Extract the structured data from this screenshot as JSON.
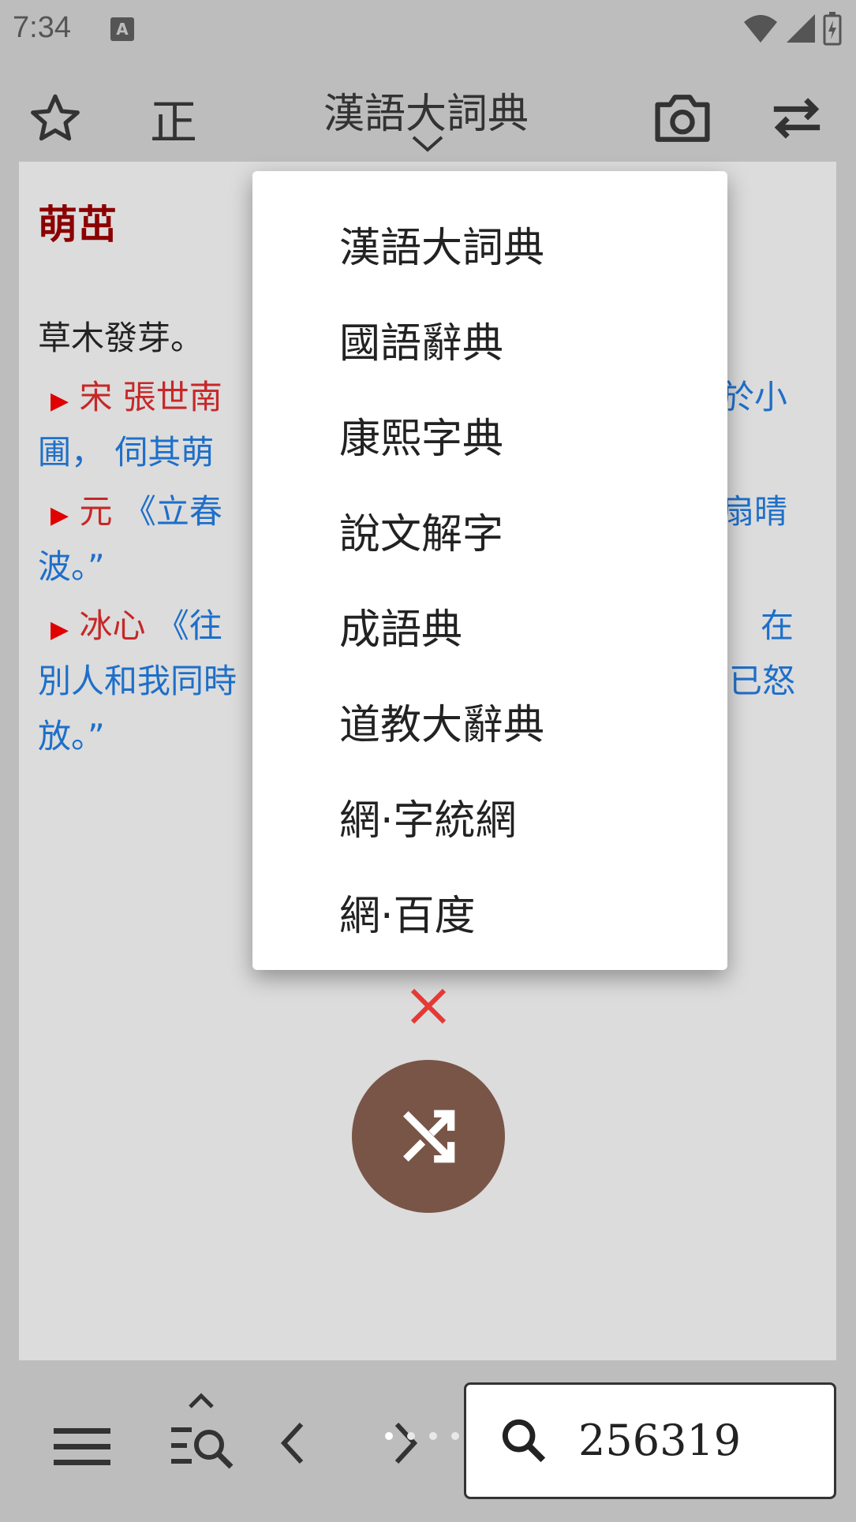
{
  "status": {
    "time": "7:34",
    "notification_icon": "A"
  },
  "toolbar": {
    "traditional_label": "正",
    "dictionary_title": "漢語大詞典"
  },
  "entry": {
    "headword": "萌茁",
    "definition": "草木發芽。",
    "citations": [
      {
        "line1_red": "宋 張世南",
        "line1_right_blue": "於小",
        "line2_left_blue": "圃， 伺其萌"
      },
      {
        "line1_red": "元",
        "line1_blue": "《立春",
        "line1_right_blue": "扇晴",
        "line2_left_blue": "波。”"
      },
      {
        "line1_red": "冰心",
        "line1_blue": "《往",
        "line1_right_blue": "在",
        "line2_left_blue": "別人和我同時",
        "line2_right_blue": "已怒",
        "line3_left_blue": "放。”"
      }
    ]
  },
  "menu": {
    "items": [
      "漢語大詞典",
      "國語辭典",
      "康熙字典",
      "說文解字",
      "成語典",
      "道教大辭典",
      "網·字統網",
      "網·百度"
    ]
  },
  "search": {
    "value": "256319"
  },
  "colors": {
    "fab": "#795548",
    "close": "#e53935",
    "headword": "#8b0000",
    "link": "#1e6fc9",
    "source": "#c62828"
  }
}
